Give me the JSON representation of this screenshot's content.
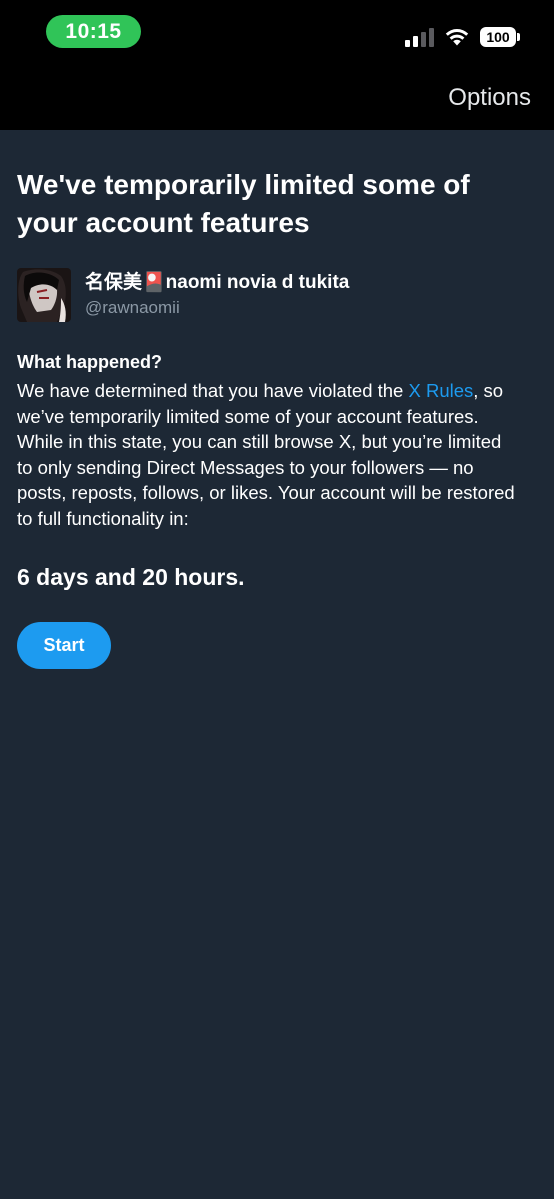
{
  "status_bar": {
    "time": "10:15",
    "battery": "100",
    "signal_bars_active": 2,
    "signal_bars_total": 4
  },
  "header": {
    "options_label": "Options"
  },
  "notice": {
    "title": "We've temporarily limited some of your account features",
    "user": {
      "display_name": "名保美🎴naomi novia d tukita",
      "handle": "@rawnaomii"
    },
    "section_heading": "What happened?",
    "body_before_link": "We have determined that you have violated the ",
    "link_text": "X Rules",
    "body_after_link": ", so we’ve temporarily limited some of your account features. While in this state, you can still browse X, but you’re limited to only sending Direct Messages to your followers — no posts, reposts, follows, or likes. Your account will be restored to full functionality in:",
    "countdown": "6 days and 20 hours.",
    "start_label": "Start"
  },
  "colors": {
    "background": "#1d2835",
    "topbar": "#000000",
    "accent": "#1d9bf0",
    "time_pill": "#30c458",
    "secondary_text": "#8b98a5"
  }
}
